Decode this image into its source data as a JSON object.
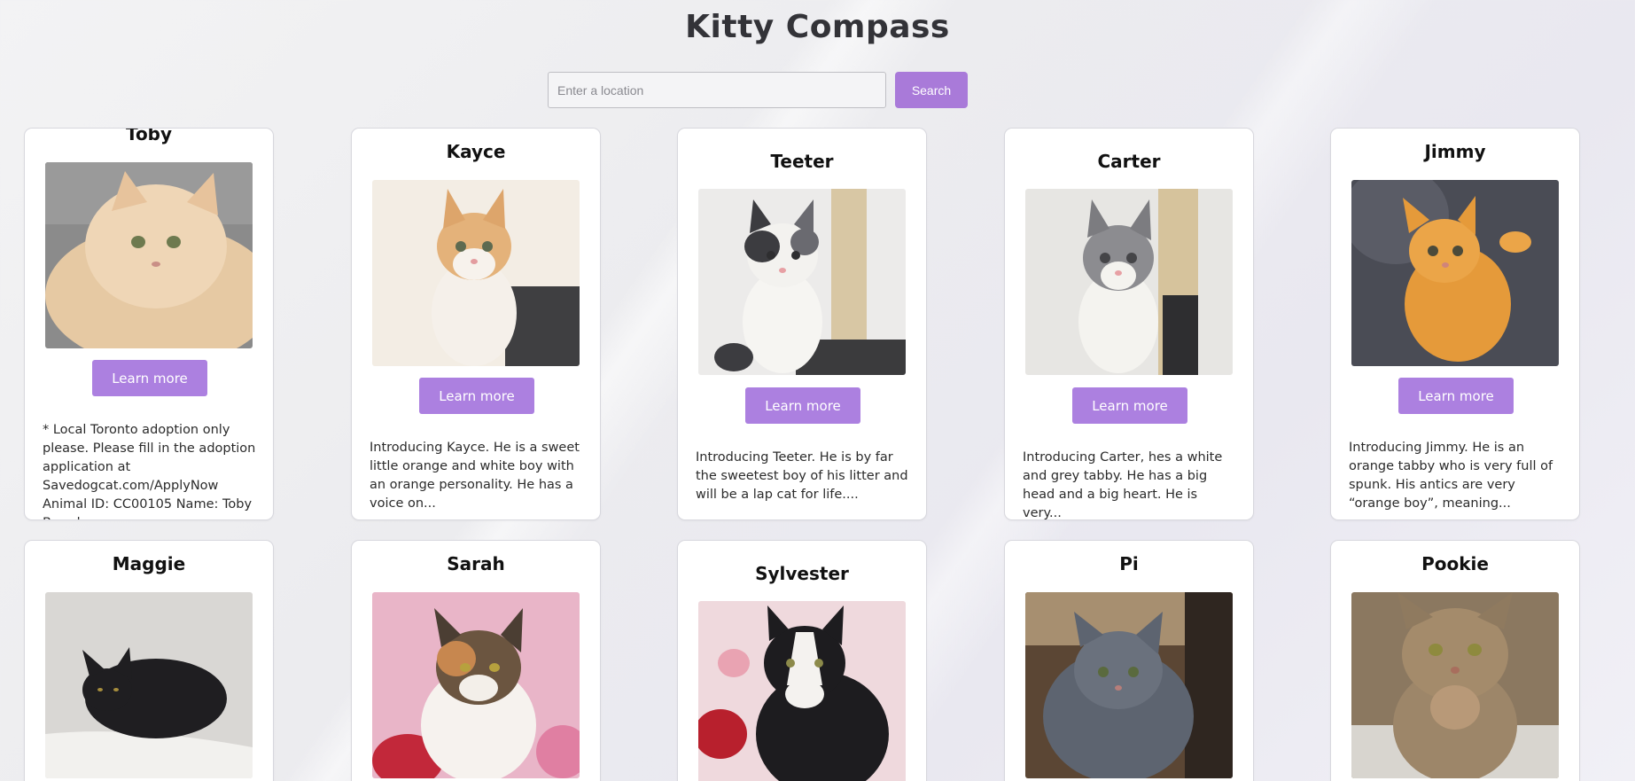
{
  "header": {
    "title": "Kitty Compass"
  },
  "search": {
    "placeholder": "Enter a location",
    "button_label": "Search"
  },
  "cards": [
    {
      "name": "Toby",
      "button": "Learn more",
      "desc": "* Local Toronto adoption only please. Please fill in the adoption application at Savedogcat.com/ApplyNow Animal ID: CC00105 Name: Toby Breed:..."
    },
    {
      "name": "Kayce",
      "button": "Learn more",
      "desc": "Introducing Kayce. He is a sweet little orange and white boy with an orange personality. He has a voice on..."
    },
    {
      "name": "Teeter",
      "button": "Learn more",
      "desc": "Introducing Teeter. He is by far the sweetest boy of his litter and will be a lap cat for life...."
    },
    {
      "name": "Carter",
      "button": "Learn more",
      "desc": "Introducing Carter, hes a white and grey tabby. He has a big head and a big heart. He is very..."
    },
    {
      "name": "Jimmy",
      "button": "Learn more",
      "desc": "Introducing Jimmy. He is an orange tabby who is very full of spunk. His antics are very “orange boy”, meaning..."
    },
    {
      "name": "Maggie"
    },
    {
      "name": "Sarah"
    },
    {
      "name": "Sylvester"
    },
    {
      "name": "Pi"
    },
    {
      "name": "Pookie"
    }
  ],
  "colors": {
    "accent": "#ac80e0",
    "search_button": "#a97ad9",
    "card_border": "#d8d8de"
  }
}
